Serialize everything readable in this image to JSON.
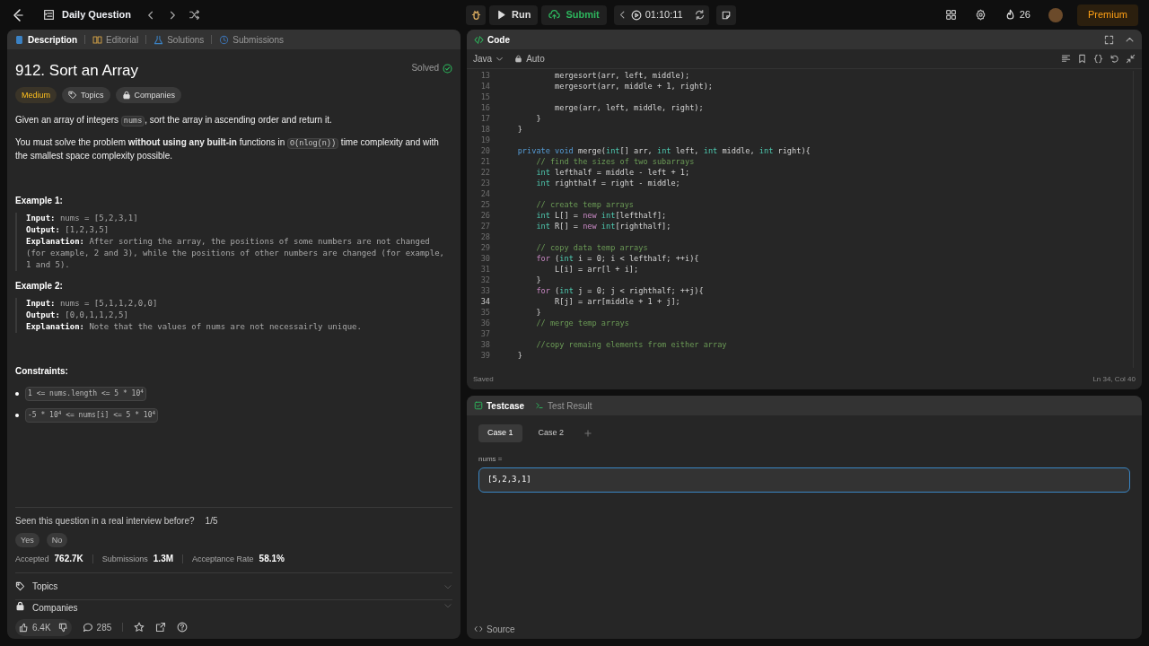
{
  "topbar": {
    "title": "Daily Question",
    "run": "Run",
    "submit": "Submit",
    "timer": "01:10:11",
    "streak": "26",
    "premium": "Premium"
  },
  "left_tabs": [
    {
      "label": "Description",
      "selected": true
    },
    {
      "label": "Editorial",
      "selected": false
    },
    {
      "label": "Solutions",
      "selected": false
    },
    {
      "label": "Submissions",
      "selected": false
    }
  ],
  "problem": {
    "title": "912. Sort an Array",
    "status": "Solved",
    "difficulty": "Medium",
    "tags": [
      "Topics",
      "Companies"
    ],
    "paragraphs": [
      [
        {
          "kind": "text",
          "s": "Given an array of integers "
        },
        {
          "kind": "code",
          "s": "nums"
        },
        {
          "kind": "text",
          "s": ", sort the array in ascending order and return it."
        }
      ],
      [
        {
          "kind": "text",
          "s": "You must solve the problem **without using any built-in** functions in "
        },
        {
          "kind": "code",
          "s": "O(nlog(n))"
        },
        {
          "kind": "text",
          "s": " time complexity and with the smallest space complexity possible."
        }
      ]
    ],
    "examples": [
      {
        "title": "Example 1:",
        "lines": [
          {
            "label": "Input:",
            "value": "nums = [5,2,3,1]"
          },
          {
            "label": "Output:",
            "value": "[1,2,3,5]"
          },
          {
            "label": "Explanation:",
            "value": "After sorting the array, the positions of some numbers are not changed (for example, 2 and 3), while the positions of other numbers are changed (for example, 1 and 5)."
          }
        ]
      },
      {
        "title": "Example 2:",
        "lines": [
          {
            "label": "Input:",
            "value": "nums = [5,1,1,2,0,0]"
          },
          {
            "label": "Output:",
            "value": "[0,0,1,1,2,5]"
          },
          {
            "label": "Explanation:",
            "value": "Note that the values of nums are not necessairly unique."
          }
        ]
      }
    ],
    "constraints_title": "Constraints:",
    "constraints": [
      "1 <= nums.length <= 5 * 10$^{4}$",
      "-5 * 10$^{4}$ <= nums[i] <= 5 * 10$^{4}$"
    ],
    "interview_question": "Seen this question in a real interview before?",
    "interview_count": "1/5",
    "answers": [
      "Yes",
      "No"
    ],
    "stats": [
      {
        "label": "Accepted",
        "value": "762.7K"
      },
      {
        "label": "Submissions",
        "value": "1.3M"
      },
      {
        "label": "Acceptance Rate",
        "value": "58.1%"
      }
    ],
    "sections": [
      "Topics",
      "Companies"
    ],
    "likes": "6.4K",
    "comments": "285"
  },
  "code_panel": {
    "title": "Code",
    "language": "Java",
    "mode": "Auto",
    "status": "Saved",
    "cursor": "Ln 34, Col 40",
    "lines": [
      {
        "n": "13",
        "current": false,
        "tokens": [
          {
            "kind": "plain",
            "s": "            mergesort(arr, left, middle);"
          }
        ]
      },
      {
        "n": "14",
        "current": false,
        "tokens": [
          {
            "kind": "plain",
            "s": "            mergesort(arr, middle + 1, right);"
          }
        ]
      },
      {
        "n": "15",
        "current": false
      },
      {
        "n": "16",
        "current": false,
        "tokens": [
          {
            "kind": "plain",
            "s": "            merge(arr, left, middle, right);"
          }
        ]
      },
      {
        "n": "17",
        "current": false,
        "tokens": [
          {
            "kind": "plain",
            "s": "        }"
          }
        ]
      },
      {
        "n": "18",
        "current": false,
        "tokens": [
          {
            "kind": "plain",
            "s": "    }"
          }
        ]
      },
      {
        "n": "19",
        "current": false
      },
      {
        "n": "20",
        "current": false,
        "tokens": [
          {
            "kind": "keyword",
            "s": "    private void "
          },
          {
            "kind": "plain",
            "s": "merge("
          },
          {
            "kind": "type",
            "s": "int"
          },
          {
            "kind": "plain",
            "s": "[] arr, "
          },
          {
            "kind": "type",
            "s": "int"
          },
          {
            "kind": "plain",
            "s": " left, "
          },
          {
            "kind": "type",
            "s": "int"
          },
          {
            "kind": "plain",
            "s": " middle, "
          },
          {
            "kind": "type",
            "s": "int"
          },
          {
            "kind": "plain",
            "s": " right){"
          }
        ]
      },
      {
        "n": "21",
        "current": false,
        "tokens": [
          {
            "kind": "comment",
            "s": "        // find the sizes of two subarrays"
          }
        ]
      },
      {
        "n": "22",
        "current": false,
        "tokens": [
          {
            "kind": "type",
            "s": "        int"
          },
          {
            "kind": "plain",
            "s": " lefthalf = middle - left + 1;"
          }
        ]
      },
      {
        "n": "23",
        "current": false,
        "tokens": [
          {
            "kind": "type",
            "s": "        int"
          },
          {
            "kind": "plain",
            "s": " righthalf = right - middle;"
          }
        ]
      },
      {
        "n": "24",
        "current": false
      },
      {
        "n": "25",
        "current": false,
        "tokens": [
          {
            "kind": "comment",
            "s": "        // create temp arrays"
          }
        ]
      },
      {
        "n": "26",
        "current": false,
        "tokens": [
          {
            "kind": "type",
            "s": "        int"
          },
          {
            "kind": "plain",
            "s": " L[] = "
          },
          {
            "kind": "control",
            "s": "new"
          },
          {
            "kind": "type",
            "s": " int"
          },
          {
            "kind": "plain",
            "s": "[lefthalf];"
          }
        ]
      },
      {
        "n": "27",
        "current": false,
        "tokens": [
          {
            "kind": "type",
            "s": "        int"
          },
          {
            "kind": "plain",
            "s": " R[] = "
          },
          {
            "kind": "control",
            "s": "new"
          },
          {
            "kind": "type",
            "s": " int"
          },
          {
            "kind": "plain",
            "s": "[righthalf];"
          }
        ]
      },
      {
        "n": "28",
        "current": false
      },
      {
        "n": "29",
        "current": false,
        "tokens": [
          {
            "kind": "comment",
            "s": "        // copy data temp arrays"
          }
        ]
      },
      {
        "n": "30",
        "current": false,
        "tokens": [
          {
            "kind": "control",
            "s": "        for"
          },
          {
            "kind": "plain",
            "s": " ("
          },
          {
            "kind": "type",
            "s": "int"
          },
          {
            "kind": "plain",
            "s": " i = 0; i < lefthalf; ++i){"
          }
        ]
      },
      {
        "n": "31",
        "current": false,
        "tokens": [
          {
            "kind": "plain",
            "s": "            L[i] = arr[l + i];"
          }
        ]
      },
      {
        "n": "32",
        "current": false,
        "tokens": [
          {
            "kind": "plain",
            "s": "        }"
          }
        ]
      },
      {
        "n": "33",
        "current": false,
        "tokens": [
          {
            "kind": "control",
            "s": "        for"
          },
          {
            "kind": "plain",
            "s": " ("
          },
          {
            "kind": "type",
            "s": "int"
          },
          {
            "kind": "plain",
            "s": " j = 0; j < righthalf; ++j){"
          }
        ]
      },
      {
        "n": "34",
        "current": true,
        "tokens": [
          {
            "kind": "plain",
            "s": "            R[j] = arr[middle + 1 + j];"
          }
        ]
      },
      {
        "n": "35",
        "current": false,
        "tokens": [
          {
            "kind": "plain",
            "s": "        }"
          }
        ]
      },
      {
        "n": "36",
        "current": false,
        "tokens": [
          {
            "kind": "comment",
            "s": "        // merge temp arrays"
          }
        ]
      },
      {
        "n": "37",
        "current": false
      },
      {
        "n": "38",
        "current": false,
        "tokens": [
          {
            "kind": "comment",
            "s": "        //copy remaing elements from either array"
          }
        ]
      },
      {
        "n": "39",
        "current": false,
        "tokens": [
          {
            "kind": "plain",
            "s": "    }"
          }
        ]
      }
    ]
  },
  "test_panel": {
    "tabs": [
      {
        "label": "Testcase",
        "selected": true
      },
      {
        "label": "Test Result",
        "selected": false
      }
    ],
    "cases": [
      {
        "label": "Case 1",
        "selected": true
      },
      {
        "label": "Case 2",
        "selected": false
      }
    ],
    "param": "nums =",
    "value": "[5,2,3,1]",
    "footer": "Source"
  }
}
